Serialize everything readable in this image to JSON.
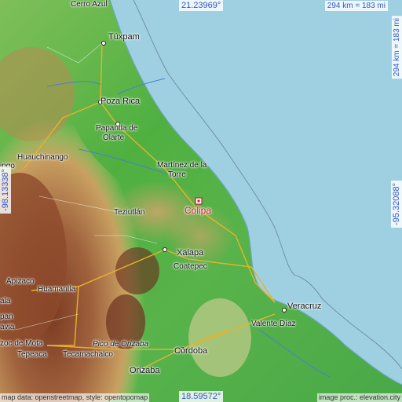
{
  "map": {
    "target": {
      "name": "Colipa",
      "marker_color": "#d11a2a"
    },
    "coordinates": {
      "top_lat": "21.23969°",
      "bottom_lat": "18.59572°",
      "left_lon": "-98.13338°",
      "right_lon": "-95.32088°"
    },
    "scale": {
      "horizontal": "294 km = 183 mi",
      "vertical": "294 km = 183 mi"
    },
    "cities": {
      "cerro_azul": "Cerro Azul",
      "tuxpam": "Túxpam",
      "poza_rica": "Poza Rica",
      "papantla": "Papantla de",
      "olarte": "Olarte",
      "huauchinango": "Huauchinango",
      "tulancingo": "ingo",
      "martinez": "Martínez de la",
      "torre": "Torre",
      "teziutlan": "Teziutlán",
      "xalapa": "Xalapa",
      "coatepec": "Coatepec",
      "apizaco": "Apizaco",
      "huamantla": "Huamantla",
      "tlaxcala_1": "ala",
      "tlaxcala_2": "pan",
      "tlaxcala_3": "avia",
      "veracruz": "Veracruz",
      "valente_diaz": "Valente Díaz",
      "zoc_de_mota": "zoc de Mota",
      "tepeaca": "Tepeaca",
      "tecamachalco": "Tecamachalco",
      "pico_de_orizaba": "Pico de Orizaba",
      "cordoba": "Córdoba",
      "orizaba": "Orizaba"
    },
    "footer": {
      "left": "map data: openstreetmap, style: opentopomap",
      "right": "image proc.: elevation.city"
    },
    "colors": {
      "sea": "#9fd0e2",
      "lowland": "#3fae3f",
      "hills": "#c9b36a",
      "mountains": "#8b4a2b",
      "roads": "#e8b32a",
      "coord_text": "#3355cc"
    }
  }
}
